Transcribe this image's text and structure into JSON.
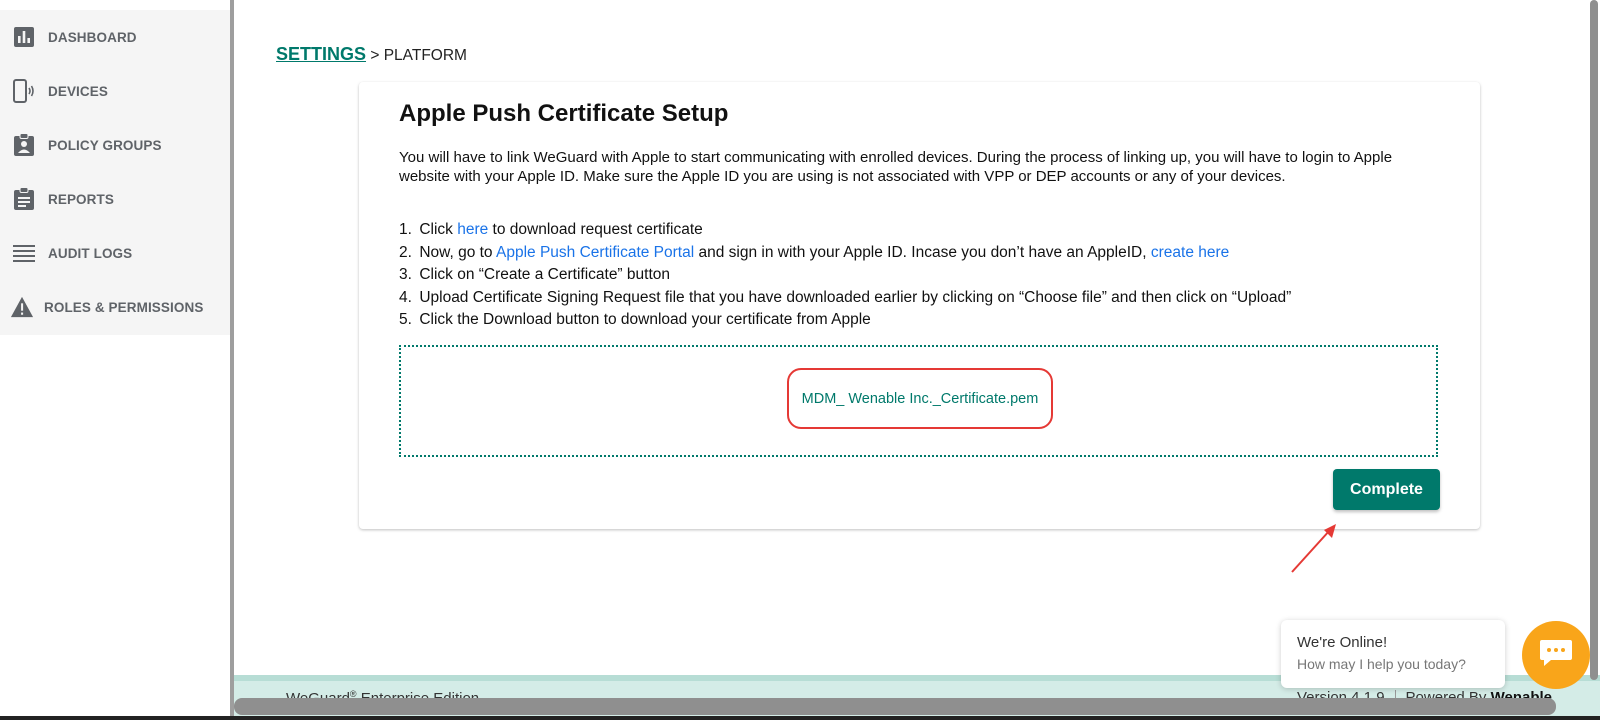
{
  "sidebar": {
    "items": [
      {
        "label": "DASHBOARD",
        "icon": "bar-chart-icon"
      },
      {
        "label": "DEVICES",
        "icon": "device-icon"
      },
      {
        "label": "POLICY GROUPS",
        "icon": "clipboard-user-icon"
      },
      {
        "label": "REPORTS",
        "icon": "clipboard-list-icon"
      },
      {
        "label": "AUDIT LOGS",
        "icon": "list-lines-icon"
      },
      {
        "label": "ROLES & PERMISSIONS",
        "icon": "warning-icon"
      }
    ]
  },
  "breadcrumb": {
    "parent": "SETTINGS",
    "separator": ">",
    "current": "PLATFORM"
  },
  "card": {
    "title": "Apple Push Certificate Setup",
    "description": "You will have to link WeGuard with Apple to start communicating with enrolled devices. During the process of linking up, you will have to login to Apple website with your Apple ID. Make sure the Apple ID you are using is not associated with VPP or DEP accounts or any of your devices.",
    "steps": {
      "s1": {
        "num": "1.",
        "pre": "Click ",
        "link": "here",
        "post": " to download request certificate"
      },
      "s2": {
        "num": "2.",
        "pre": "Now, go to ",
        "link": "Apple Push Certificate Portal",
        "mid": " and sign in with your Apple ID. Incase you don’t have an AppleID, ",
        "link2": "create here"
      },
      "s3": {
        "num": "3.",
        "text": "Click on “Create a Certificate” button"
      },
      "s4": {
        "num": "4.",
        "text": "Upload Certificate Signing Request file that you have downloaded earlier by clicking on “Choose file” and then click on “Upload”"
      },
      "s5": {
        "num": "5.",
        "text": "Click the Download button to download your certificate from Apple"
      }
    },
    "uploaded_file": "MDM_ Wenable Inc._Certificate.pem",
    "complete_label": "Complete"
  },
  "footer": {
    "product": "WeGuard",
    "edition": " Enterprise Edition",
    "version": "Version 4.1.9",
    "powered_by": "Powered By",
    "company": "Wenable"
  },
  "chat": {
    "title": "We're Online!",
    "subtitle": "How may I help you today?"
  },
  "colors": {
    "accent": "#00796b",
    "link": "#1a73e8",
    "highlight": "#e53935",
    "chat": "#f9a51a"
  }
}
